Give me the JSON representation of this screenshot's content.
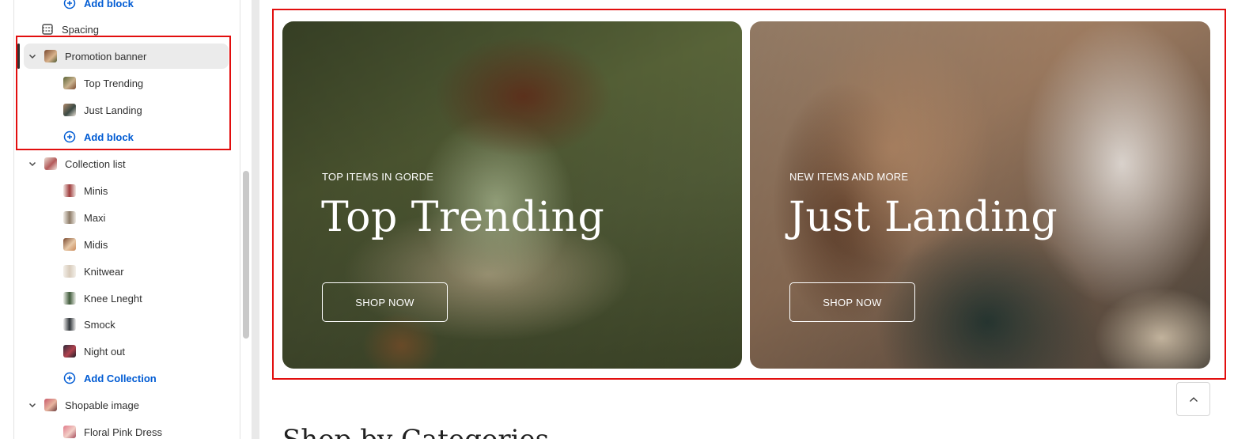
{
  "sidebar": {
    "add_block_top": "Add block",
    "spacing": "Spacing",
    "promotion_banner": {
      "label": "Promotion banner",
      "blocks": [
        "Top Trending",
        "Just Landing"
      ],
      "add_block": "Add block"
    },
    "collection_list": {
      "label": "Collection list",
      "items": [
        "Minis",
        "Maxi",
        "Midis",
        "Knitwear",
        "Knee Lneght",
        "Smock",
        "Night out"
      ],
      "add_collection": "Add Collection"
    },
    "shopable_image": {
      "label": "Shopable image",
      "items": [
        "Floral Pink Dress"
      ]
    }
  },
  "preview": {
    "banners": [
      {
        "eyebrow": "TOP ITEMS IN GORDE",
        "title": "Top Trending",
        "button": "SHOP NOW"
      },
      {
        "eyebrow": "NEW ITEMS AND MORE",
        "title": "Just Landing",
        "button": "SHOP NOW"
      }
    ],
    "next_section_title": "Shop by Categories"
  },
  "colors": {
    "accent": "#005bd3",
    "highlight": "#e20e0e",
    "text": "#303030"
  },
  "icons": {
    "add": "plus-circle-icon",
    "spacing": "spacing-icon",
    "expand": "chevron-down-icon",
    "scroll_top": "chevron-up-icon"
  }
}
